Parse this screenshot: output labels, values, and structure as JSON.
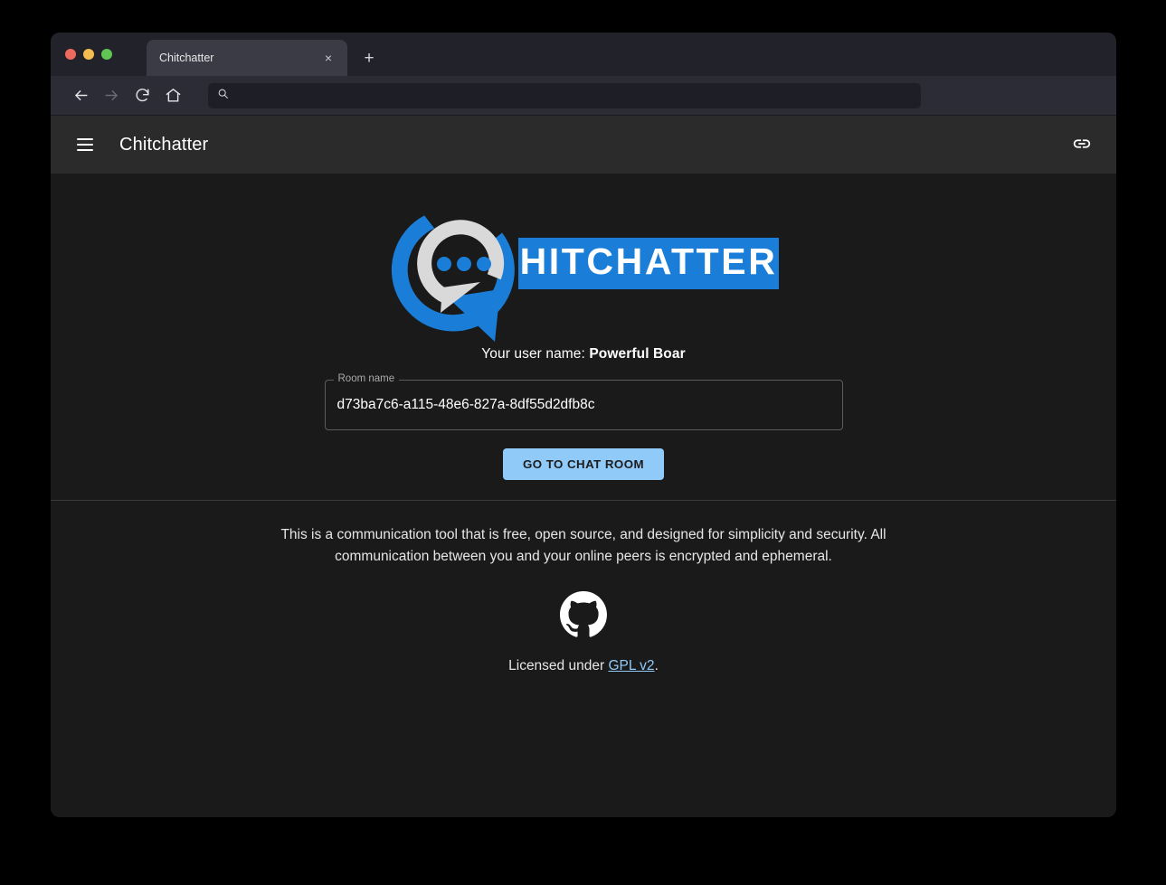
{
  "browser": {
    "tab": {
      "title": "Chitchatter",
      "close_label": "×"
    },
    "new_tab_label": "+",
    "nav": {
      "back_icon": "arrow-left-icon",
      "forward_icon": "arrow-right-icon",
      "reload_icon": "reload-icon",
      "home_icon": "home-icon"
    },
    "url_bar": {
      "value": "",
      "placeholder": "",
      "icon": "search-icon"
    }
  },
  "app_bar": {
    "menu_icon": "hamburger-menu-icon",
    "title": "Chitchatter",
    "link_icon": "link-icon"
  },
  "hero": {
    "logo": {
      "alt": "Chitchatter logo",
      "wordmark": "HITCHATTER",
      "brand_blue": "#1a7ed8",
      "bubble_gray": "#d9d9d9",
      "wordmark_color": "#ffffff"
    },
    "username_prefix": "Your user name: ",
    "username": "Powerful Boar",
    "room_field": {
      "label": "Room name",
      "value": "d73ba7c6-a115-48e6-827a-8df55d2dfb8c",
      "placeholder": ""
    },
    "cta_label": "GO TO CHAT ROOM"
  },
  "footer": {
    "blurb": "This is a communication tool that is free, open source, and designed for simplicity and security. All communication between you and your online peers is encrypted and ephemeral.",
    "github_icon": "github-icon",
    "license_prefix": "Licensed under ",
    "license_link": "GPL v2",
    "license_suffix": "."
  },
  "colors": {
    "accent": "#90caf9",
    "brand": "#1a7ed8",
    "page_bg": "#1a1a1a",
    "app_bar_bg": "#2b2b2b"
  }
}
